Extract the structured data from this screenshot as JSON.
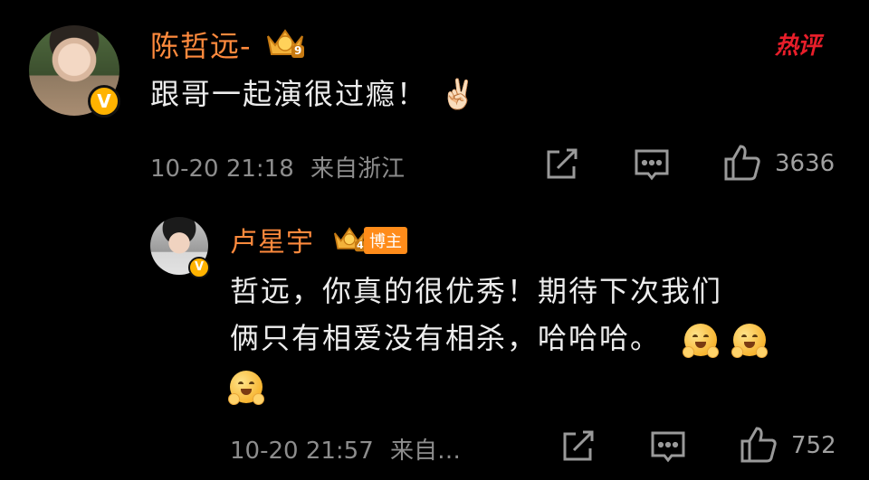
{
  "hot_logo": "热评",
  "comment1": {
    "username": "陈哲远-",
    "level": "9",
    "text": "跟哥一起演很过瘾！",
    "emoji": "✌🏻",
    "time": "10-20 21:18",
    "location": "来自浙江",
    "likes": "3636"
  },
  "reply1": {
    "username": "卢星宇",
    "level": "4",
    "tag": "博主",
    "text_line1": "哲远，你真的很优秀！期待下次我们",
    "text_line2": "俩只有相爱没有相杀，哈哈哈。",
    "time": "10-20 21:57",
    "location": "来自…",
    "likes": "752"
  },
  "icons": {
    "verified": "V",
    "forward": "share-icon",
    "comment": "comment-icon",
    "like": "like-icon"
  },
  "colors": {
    "username": "#ff8a3d",
    "badge": "#ffb300",
    "hot": "#e81e2a"
  }
}
